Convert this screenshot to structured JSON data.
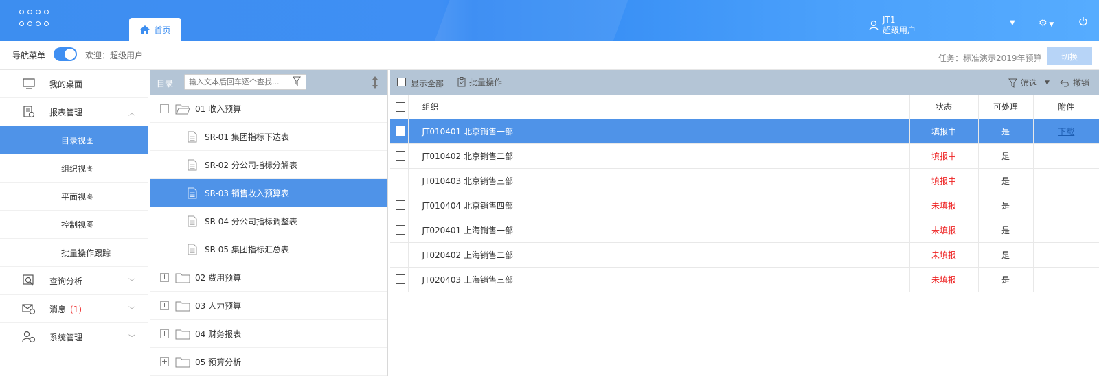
{
  "header": {
    "home_tab": "首页",
    "user_id": "JT1",
    "user_role": "超级用户"
  },
  "subbar": {
    "nav_label": "导航菜单",
    "welcome": "欢迎：超级用户",
    "task": "任务：标准演示2019年预算",
    "switch_button": "切换"
  },
  "sidebar": {
    "items": [
      {
        "label": "我的桌面"
      },
      {
        "label": "报表管理"
      },
      {
        "label": "目录视图"
      },
      {
        "label": "组织视图"
      },
      {
        "label": "平面视图"
      },
      {
        "label": "控制视图"
      },
      {
        "label": "批量操作跟踪"
      },
      {
        "label": "查询分析"
      },
      {
        "label": "消息",
        "badge": "(1)"
      },
      {
        "label": "系统管理"
      }
    ]
  },
  "catalog": {
    "title": "目录",
    "search_placeholder": "输入文本后回车逐个查找...",
    "nodes": [
      {
        "label": "01 收入预算"
      },
      {
        "label": "SR-01 集团指标下达表"
      },
      {
        "label": "SR-02 分公司指标分解表"
      },
      {
        "label": "SR-03 销售收入预算表"
      },
      {
        "label": "SR-04 分公司指标调整表"
      },
      {
        "label": "SR-05 集团指标汇总表"
      },
      {
        "label": "02 费用预算"
      },
      {
        "label": "03 人力预算"
      },
      {
        "label": "04 财务报表"
      },
      {
        "label": "05 预算分析"
      }
    ]
  },
  "toolbar": {
    "show_all": "显示全部",
    "batch": "批量操作",
    "filter": "筛选",
    "undo": "撤销"
  },
  "table": {
    "headers": {
      "org": "组织",
      "status": "状态",
      "processable": "可处理",
      "attachment": "附件"
    },
    "rows": [
      {
        "org": "JT010401 北京销售一部",
        "status": "填报中",
        "processable": "是",
        "attachment": "下载"
      },
      {
        "org": "JT010402 北京销售二部",
        "status": "填报中",
        "processable": "是",
        "attachment": ""
      },
      {
        "org": "JT010403 北京销售三部",
        "status": "填报中",
        "processable": "是",
        "attachment": ""
      },
      {
        "org": "JT010404 北京销售四部",
        "status": "未填报",
        "processable": "是",
        "attachment": ""
      },
      {
        "org": "JT020401 上海销售一部",
        "status": "未填报",
        "processable": "是",
        "attachment": ""
      },
      {
        "org": "JT020402 上海销售二部",
        "status": "未填报",
        "processable": "是",
        "attachment": ""
      },
      {
        "org": "JT020403 上海销售三部",
        "status": "未填报",
        "processable": "是",
        "attachment": ""
      }
    ]
  }
}
